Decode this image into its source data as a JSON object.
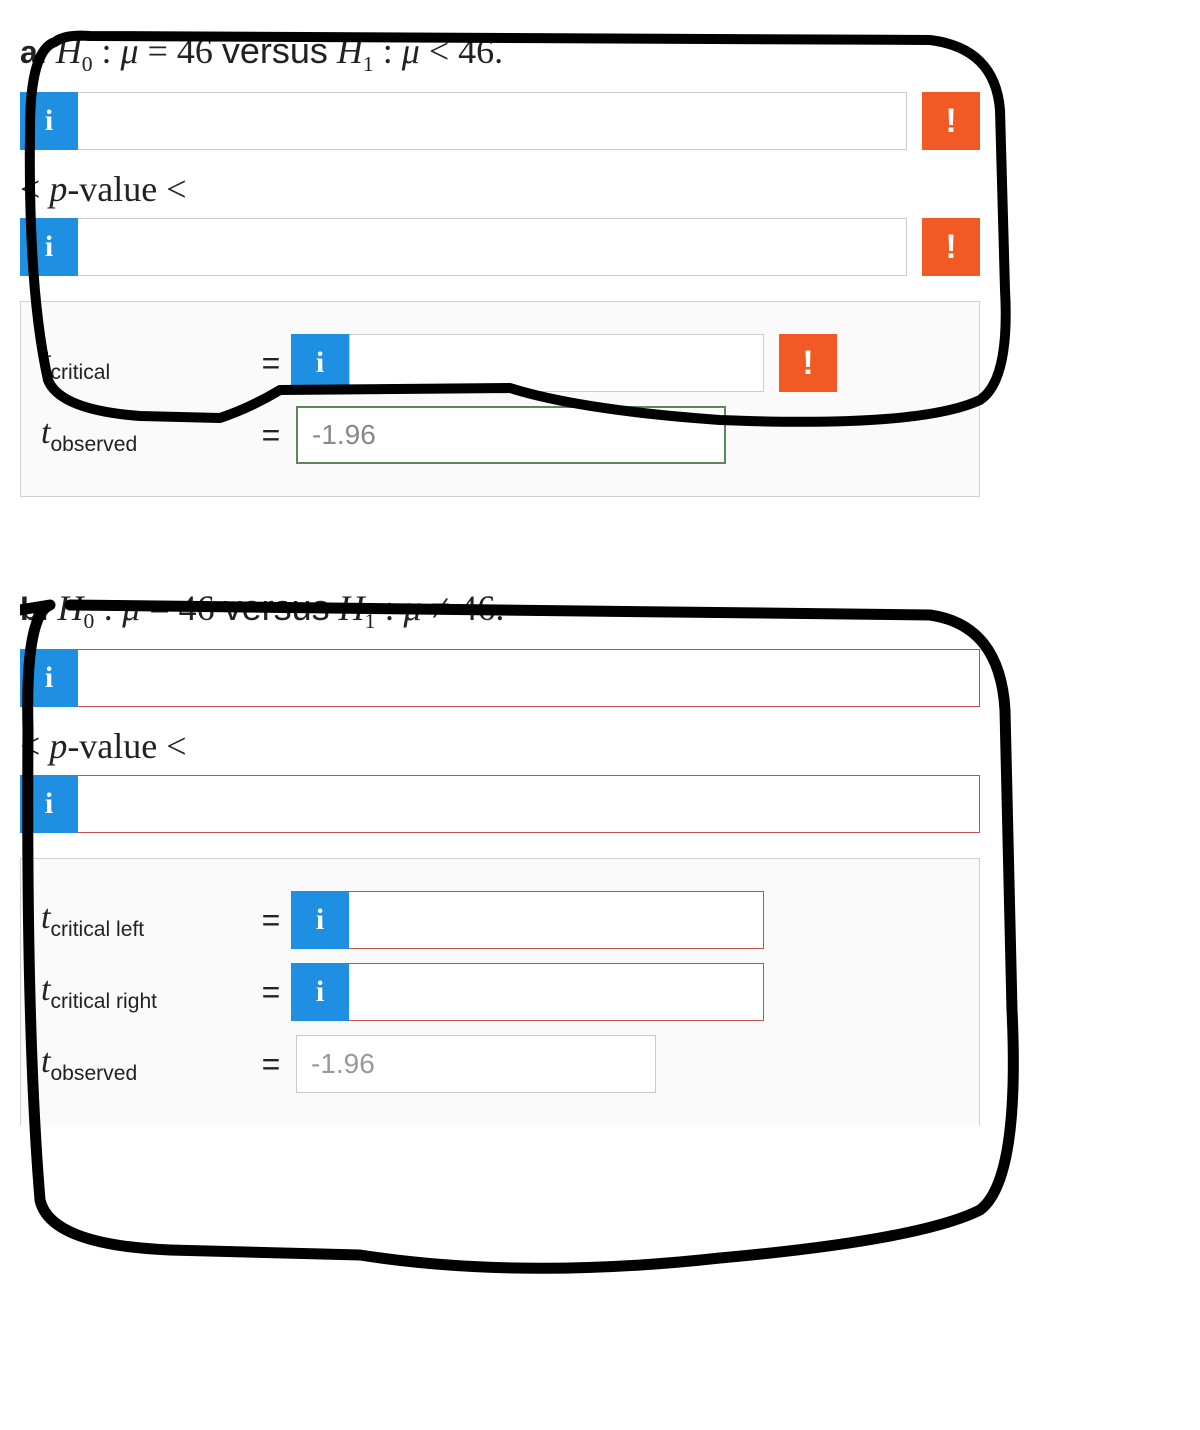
{
  "partA": {
    "label": "a.",
    "h0": "H",
    "h0sub": "0",
    "mu": "μ",
    "eq46": "= 46",
    "versus": "versus",
    "h1": "H",
    "h1sub": "1",
    "lt46": "< 46.",
    "pvalue_label_lt1": "<",
    "pvalue_text": "p",
    "pvalue_label_lt2": "-value <",
    "tcritical_label": "t",
    "tcritical_sub": "critical",
    "tobserved_label": "t",
    "tobserved_sub": "observed",
    "tobserved_value": "-1.96",
    "equals": "=",
    "info": "i",
    "bang": "!"
  },
  "partB": {
    "label": "b.",
    "h0": "H",
    "h0sub": "0",
    "mu": "μ",
    "eq46": "= 46",
    "versus": "versus",
    "h1": "H",
    "h1sub": "1",
    "neq46": "≠ 46.",
    "pvalue_label_lt1": "<",
    "pvalue_text": "p",
    "pvalue_label_lt2": "-value <",
    "tcritical_left_label": "t",
    "tcritical_left_sub": "critical left",
    "tcritical_right_label": "t",
    "tcritical_right_sub": "critical right",
    "tobserved_label": "t",
    "tobserved_sub": "observed",
    "tobserved_value": "-1.96",
    "equals": "=",
    "info": "i"
  }
}
